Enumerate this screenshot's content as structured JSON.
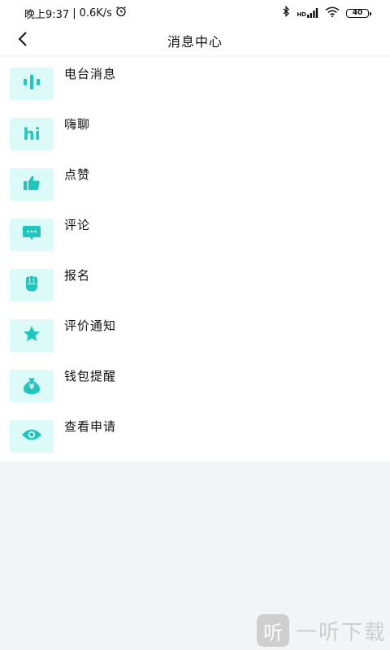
{
  "status_bar": {
    "time": "晚上9:37",
    "network_speed": "0.6K/s",
    "battery_level": "40",
    "network_badge": "HD",
    "icons": [
      "alarm-icon",
      "bluetooth-icon",
      "signal-icon",
      "wifi-icon",
      "battery-icon"
    ]
  },
  "header": {
    "title": "消息中心",
    "back_icon": "chevron-left-icon"
  },
  "accent_color": "#1fc6bd",
  "icon_background": "#dcfaf8",
  "items": [
    {
      "label": "电台消息",
      "icon": "audio-bars-icon"
    },
    {
      "label": "嗨聊",
      "icon": "hi-icon",
      "icon_text": "hi"
    },
    {
      "label": "点赞",
      "icon": "thumbs-up-icon"
    },
    {
      "label": "评论",
      "icon": "comment-bubble-icon"
    },
    {
      "label": "报名",
      "icon": "fist-icon"
    },
    {
      "label": "评价通知",
      "icon": "star-icon"
    },
    {
      "label": "钱包提醒",
      "icon": "money-bag-icon",
      "icon_text": "¥"
    },
    {
      "label": "查看申请",
      "icon": "eye-icon"
    }
  ],
  "watermark": {
    "logo_char": "听",
    "text": "一听下载"
  }
}
